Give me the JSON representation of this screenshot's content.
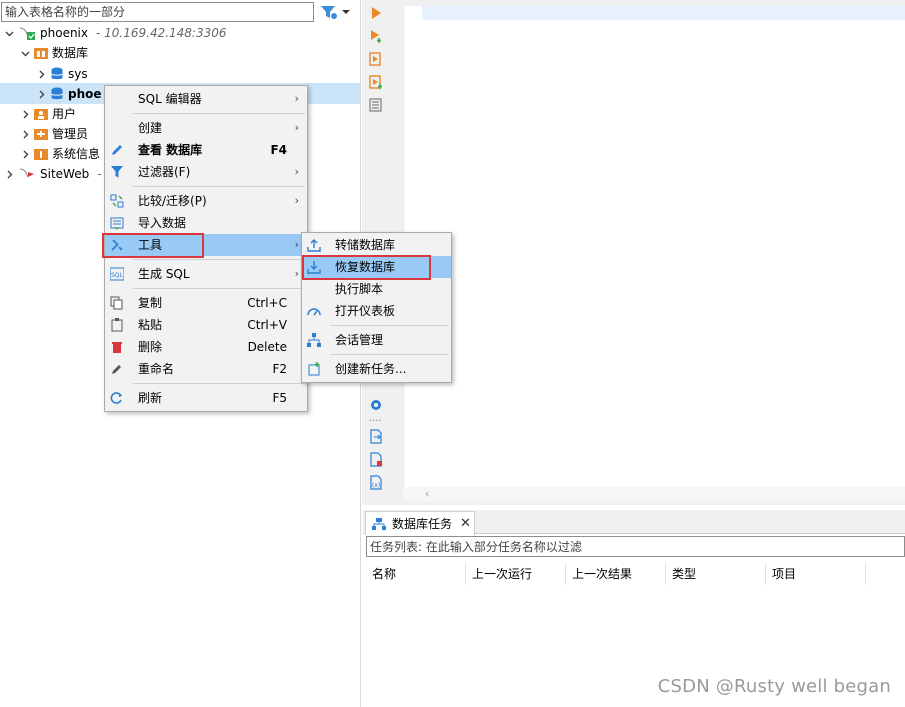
{
  "navigator": {
    "filter_placeholder": "输入表格名称的一部分",
    "connection": {
      "name": "phoenix",
      "address": "- 10.169.42.148:3306"
    },
    "folder_databases": "数据库",
    "db_sys": "sys",
    "db_selected": "phoe",
    "folder_users": "用户",
    "folder_admins": "管理员",
    "folder_sysinfo": "系统信息",
    "connection2": {
      "name": "SiteWeb",
      "address": "-"
    }
  },
  "context_menu": {
    "items": [
      {
        "label": "SQL 编辑器",
        "shortcut": "",
        "submenu": true
      },
      {
        "label": "创建",
        "shortcut": "",
        "submenu": true
      },
      {
        "label": "查看 数据库",
        "shortcut": "F4",
        "submenu": false
      },
      {
        "label": "过滤器(F)",
        "shortcut": "",
        "submenu": true
      },
      {
        "label": "比较/迁移(P)",
        "shortcut": "",
        "submenu": true
      },
      {
        "label": "导入数据",
        "shortcut": "",
        "submenu": false
      },
      {
        "label": "工具",
        "shortcut": "",
        "submenu": true
      },
      {
        "label": "生成 SQL",
        "shortcut": "",
        "submenu": true
      },
      {
        "label": "复制",
        "shortcut": "Ctrl+C",
        "submenu": false
      },
      {
        "label": "粘贴",
        "shortcut": "Ctrl+V",
        "submenu": false
      },
      {
        "label": "删除",
        "shortcut": "Delete",
        "submenu": false
      },
      {
        "label": "重命名",
        "shortcut": "F2",
        "submenu": false
      },
      {
        "label": "刷新",
        "shortcut": "F5",
        "submenu": false
      }
    ]
  },
  "tools_submenu": {
    "items": [
      {
        "label": "转储数据库"
      },
      {
        "label": "恢复数据库"
      },
      {
        "label": "执行脚本"
      },
      {
        "label": "打开仪表板"
      },
      {
        "label": "会话管理"
      },
      {
        "label": "创建新任务..."
      }
    ]
  },
  "bottom_panel": {
    "tab_label": "数据库任务",
    "filter_placeholder": "任务列表: 在此输入部分任务名称以过滤",
    "columns": [
      "名称",
      "上一次运行",
      "上一次结果",
      "类型",
      "项目"
    ]
  },
  "watermark": "CSDN @Rusty well began",
  "colors": {
    "highlight": "#99c9f5",
    "selection": "#cce4f7",
    "annotation_box": "#d9363e",
    "accent_orange": "#e8892a",
    "db_blue": "#2a7fd4"
  }
}
